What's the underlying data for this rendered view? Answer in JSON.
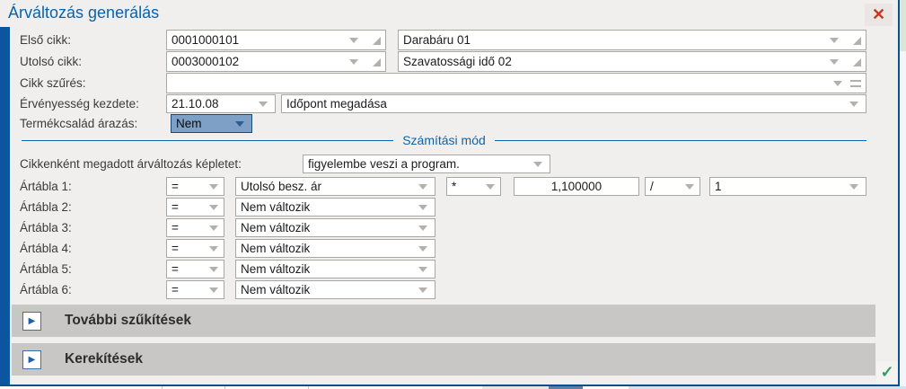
{
  "window": {
    "title": "Árváltozás generálás"
  },
  "icons": {
    "close": "✕",
    "confirm": "✓",
    "expand": "▶"
  },
  "fields": {
    "first_item": {
      "label": "Első cikk:",
      "code": "0001000101",
      "name": "Darabáru 01"
    },
    "last_item": {
      "label": "Utolsó cikk:",
      "code": "0003000102",
      "name": "Szavatossági idő 02"
    },
    "item_filter": {
      "label": "Cikk szűrés:",
      "value": ""
    },
    "validity": {
      "label": "Érvényesség kezdete:",
      "date": "21.10.08",
      "time_mode": "Időpont megadása"
    },
    "family": {
      "label": "Termékcsalád árazás:",
      "value": "Nem"
    }
  },
  "section": {
    "title": "Számítási mód"
  },
  "formula_row": {
    "label": "Cikkenként megadott árváltozás képletet:",
    "value": "figyelembe veszi a program."
  },
  "price_tables": [
    {
      "label": "Ártábla 1:",
      "op": "=",
      "base": "Utolsó besz. ár",
      "mul_op": "*",
      "factor": "1,100000",
      "div_op": "/",
      "divisor": "1"
    },
    {
      "label": "Ártábla 2:",
      "op": "=",
      "base": "Nem változik"
    },
    {
      "label": "Ártábla 3:",
      "op": "=",
      "base": "Nem változik"
    },
    {
      "label": "Ártábla 4:",
      "op": "=",
      "base": "Nem változik"
    },
    {
      "label": "Ártábla 5:",
      "op": "=",
      "base": "Nem változik"
    },
    {
      "label": "Ártábla 6:",
      "op": "=",
      "base": "Nem változik"
    }
  ],
  "accordions": [
    {
      "label": "További szűkítések"
    },
    {
      "label": "Kerekítések"
    }
  ],
  "colors": {
    "accent_blue": "#0c62aa",
    "selection_blue": "#7e9fc6",
    "frame_blue": "#0e4f8e",
    "close_red": "#c8371f",
    "confirm_green": "#2f9e68"
  }
}
